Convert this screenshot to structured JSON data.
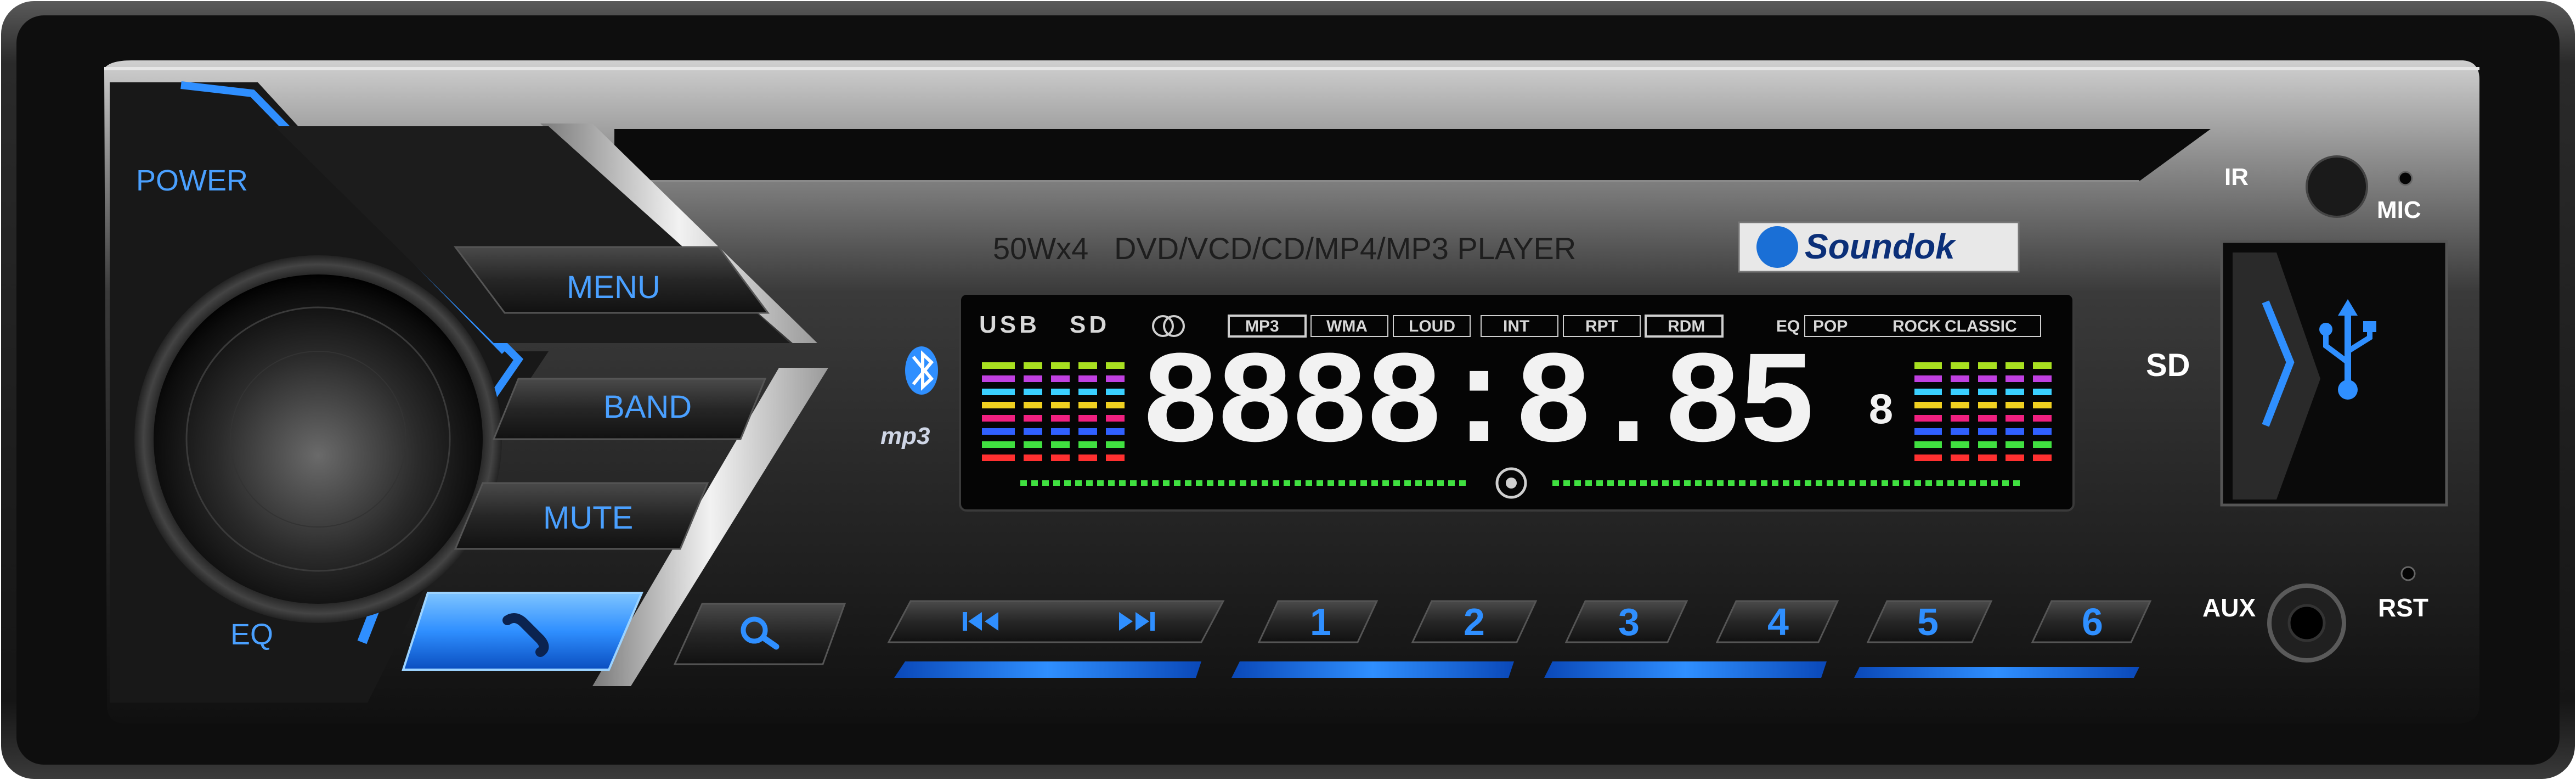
{
  "device": {
    "power_label": "POWER",
    "eq_label": "EQ",
    "menu_label": "MENU",
    "band_label": "BAND",
    "mute_label": "MUTE",
    "ir_label": "IR",
    "mic_label": "MIC",
    "sd_label": "SD",
    "aux_label": "AUX",
    "rst_label": "RST",
    "spec_text": "50Wx4   DVD/VCD/CD/MP4/MP3 PLAYER",
    "brand": "Soundok",
    "mp3_logo": "mp3"
  },
  "display": {
    "usb": "USB",
    "sd": "SD",
    "mp3": "MP3",
    "wma": "WMA",
    "loud": "LOUD",
    "int": "INT",
    "rpt": "RPT",
    "rdm": "RDM",
    "eq": "EQ",
    "pop": "POP",
    "rock": "ROCK",
    "classic": "CLASSIC",
    "digits": "8888:8.85",
    "small_digit": "8"
  },
  "presets": [
    "1",
    "2",
    "3",
    "4",
    "5",
    "6"
  ],
  "icons": {
    "call": "phone-icon",
    "search": "search-icon",
    "prev": "prev-track-icon",
    "next": "next-track-icon",
    "bluetooth": "bluetooth-icon",
    "usb": "usb-icon"
  },
  "colors": {
    "accent": "#2f8fff",
    "label": "#4aa0ff",
    "body": "#1a1a1a"
  }
}
